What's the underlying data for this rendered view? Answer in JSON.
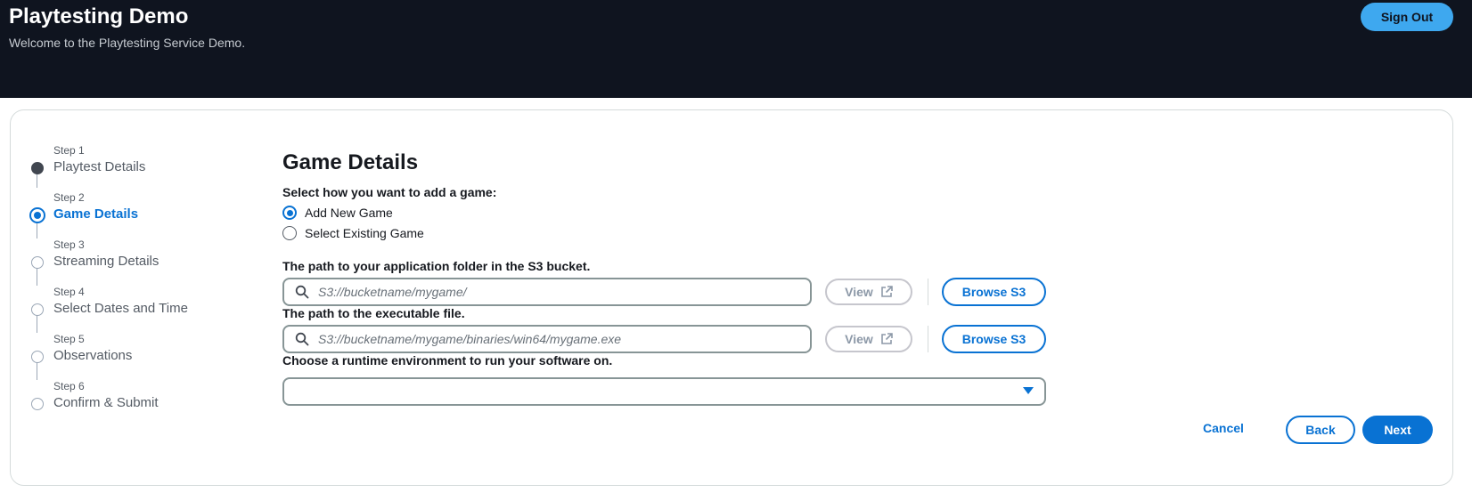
{
  "header": {
    "title": "Playtesting Demo",
    "subtitle": "Welcome to the Playtesting Service Demo.",
    "signout_label": "Sign Out"
  },
  "steps": [
    {
      "num": "Step 1",
      "name": "Playtest Details",
      "state": "done"
    },
    {
      "num": "Step 2",
      "name": "Game Details",
      "state": "current"
    },
    {
      "num": "Step 3",
      "name": "Streaming Details",
      "state": "pending"
    },
    {
      "num": "Step 4",
      "name": "Select Dates and Time",
      "state": "pending"
    },
    {
      "num": "Step 5",
      "name": "Observations",
      "state": "pending"
    },
    {
      "num": "Step 6",
      "name": "Confirm & Submit",
      "state": "pending"
    }
  ],
  "form": {
    "title": "Game Details",
    "add_game_label": "Select how you want to add a game:",
    "options": [
      {
        "label": "Add New Game",
        "checked": true
      },
      {
        "label": "Select Existing Game",
        "checked": false
      }
    ],
    "app_folder_label": "The path to your application folder in the S3 bucket.",
    "app_folder_placeholder": "S3://bucketname/mygame/",
    "executable_label": "The path to the executable file.",
    "executable_placeholder": "S3://bucketname/mygame/binaries/win64/mygame.exe",
    "view_label": "View",
    "browse_label": "Browse S3",
    "runtime_label": "Choose a runtime environment to run your software on.",
    "runtime_value": ""
  },
  "actions": {
    "cancel_label": "Cancel",
    "back_label": "Back",
    "next_label": "Next"
  },
  "colors": {
    "header_bg": "#0f141f",
    "accent": "#0972d3",
    "signout_bg": "#3ea8ef"
  },
  "icons": [
    "search-icon",
    "external-link-icon",
    "caret-down-icon"
  ]
}
